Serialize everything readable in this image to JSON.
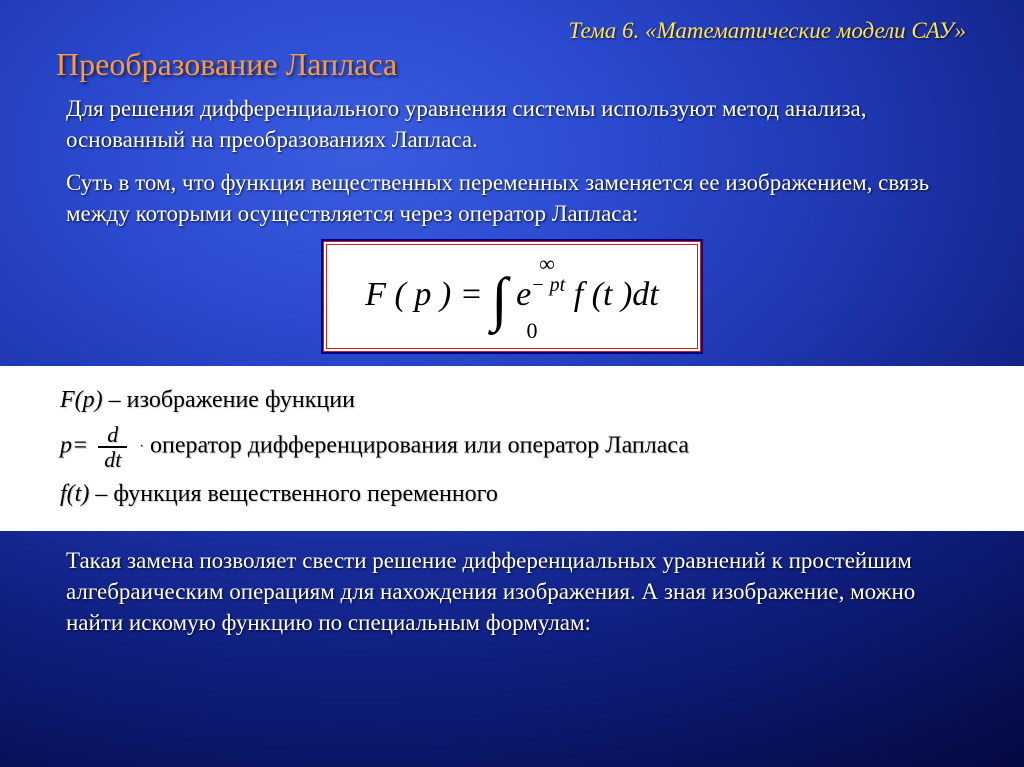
{
  "topic": "Тема 6. «Математические модели САУ»",
  "title": "Преобразование Лапласа",
  "para1": "Для решения дифференциального уравнения системы используют метод анализа, основанный на преобразованиях Лапласа.",
  "para2": "Суть в том, что функция вещественных переменных заменяется ее изображением, связь между которыми осуществляется через оператор Лапласа:",
  "formula": {
    "upper": "∞",
    "lhs": "F ( p ) =",
    "integral": "∫",
    "exp_base": "e",
    "exp_sup": "− pt",
    "rhs": " f (t )dt",
    "lower": "0"
  },
  "defs": {
    "line1_lead": "F(p)",
    "line1_rest": " – изображение функции",
    "line2_lead": "p=",
    "frac_num": "d",
    "frac_den": "dt",
    "line2_rest": "  оператор дифференцирования или оператор Лапласа",
    "line3_lead": "f(t)",
    "line3_rest": " – функция вещественного переменного"
  },
  "para3": "Такая замена позволяет свести решение дифференциальных уравнений к простейшим алгебраическим операциям для нахождения изображения. А зная изображение, можно найти искомую функцию по специальным формулам:"
}
